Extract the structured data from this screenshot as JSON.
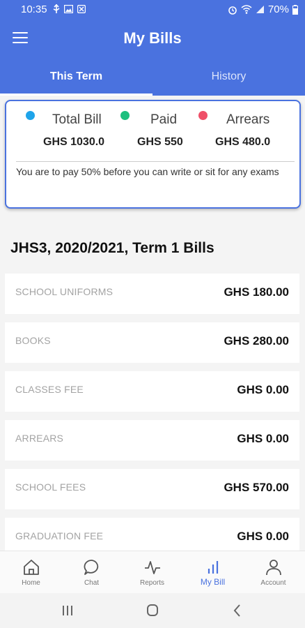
{
  "status_bar": {
    "time": "10:35",
    "battery": "70%",
    "left_icons": [
      "usb-icon",
      "image-icon",
      "notification-icon"
    ],
    "right_icons": [
      "alarm-icon",
      "wifi-icon",
      "signal-icon"
    ]
  },
  "header": {
    "title": "My Bills",
    "menu_icon": "hamburger-menu-icon",
    "tabs": [
      {
        "label": "This Term",
        "active": true
      },
      {
        "label": "History",
        "active": false
      }
    ],
    "color": "#4a72df"
  },
  "summary": {
    "items": [
      {
        "label": "Total Bill",
        "amount": "GHS 1030.0",
        "color": "#1ea4ea"
      },
      {
        "label": "Paid",
        "amount": "GHS 550",
        "color": "#1cbf7e"
      },
      {
        "label": "Arrears",
        "amount": "GHS 480.0",
        "color": "#ef4f68"
      }
    ],
    "note": "You are to pay 50% before you can write or sit for any exams"
  },
  "bills": {
    "title": "JHS3, 2020/2021, Term 1 Bills",
    "items": [
      {
        "name": "SCHOOL UNIFORMS",
        "amount": "GHS 180.00"
      },
      {
        "name": "BOOKS",
        "amount": "GHS 280.00"
      },
      {
        "name": "CLASSES FEE",
        "amount": "GHS 0.00"
      },
      {
        "name": "ARREARS",
        "amount": "GHS 0.00"
      },
      {
        "name": "SCHOOL FEES",
        "amount": "GHS 570.00"
      },
      {
        "name": "GRADUATION FEE",
        "amount": "GHS 0.00"
      }
    ]
  },
  "bottom_nav": {
    "items": [
      {
        "label": "Home",
        "icon": "home-icon",
        "active": false
      },
      {
        "label": "Chat",
        "icon": "chat-icon",
        "active": false
      },
      {
        "label": "Reports",
        "icon": "activity-icon",
        "active": false
      },
      {
        "label": "My Bill",
        "icon": "bar-chart-icon",
        "active": true
      },
      {
        "label": "Account",
        "icon": "user-icon",
        "active": false
      }
    ]
  },
  "system_nav": {
    "buttons": [
      "recent-apps-icon",
      "home-circle-icon",
      "back-icon"
    ]
  }
}
